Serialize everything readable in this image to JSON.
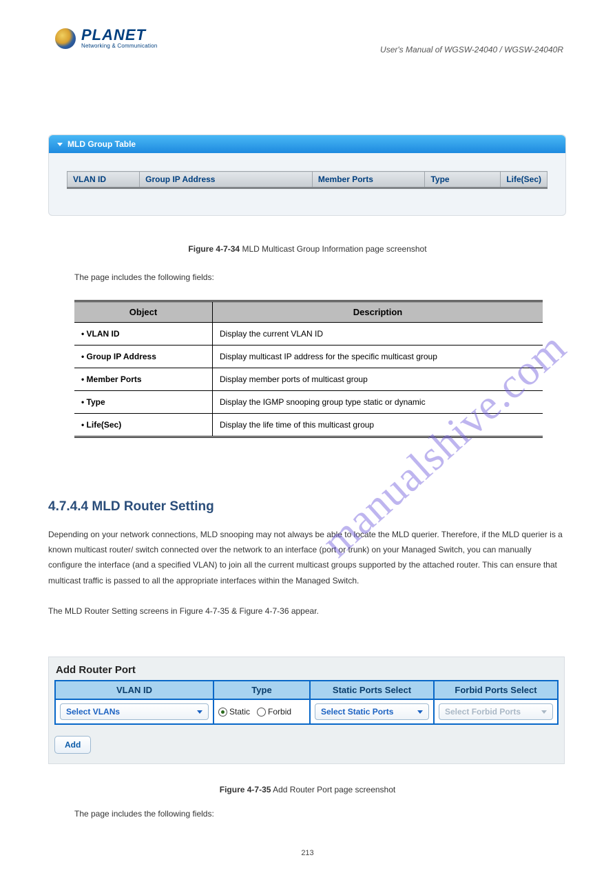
{
  "logo": {
    "main": "PLANET",
    "sub": "Networking & Communication"
  },
  "manual_header": "User's Manual of WGSW-24040 / WGSW-24040R",
  "watermark": "manualshive.com",
  "panel1": {
    "title": "MLD Group Table",
    "columns": [
      "VLAN ID",
      "Group IP Address",
      "Member Ports",
      "Type",
      "Life(Sec)"
    ]
  },
  "fig1": {
    "caption_strong": "Figure 4-7-34",
    "caption_rest": " MLD Multicast Group Information page screenshot"
  },
  "desc1": {
    "intro": "The page includes the following fields:",
    "header_obj": "Object",
    "header_desc": "Description",
    "rows": [
      {
        "obj": "• VLAN ID",
        "desc": "Display the current VLAN ID"
      },
      {
        "obj": "• Group IP Address",
        "desc": "Display multicast IP address for the specific multicast group"
      },
      {
        "obj": "• Member Ports",
        "desc": "Display member ports of multicast group"
      },
      {
        "obj": "• Type",
        "desc": "Display the IGMP snooping group type static or dynamic"
      },
      {
        "obj": "• Life(Sec)",
        "desc": "Display the life time of this multicast group"
      }
    ]
  },
  "section": {
    "heading": "4.7.4.4 MLD Router Setting",
    "body_1": "Depending on your network connections, MLD snooping may not always be able to locate the MLD querier. Therefore, if the MLD querier is a known multicast router/ switch connected over the network to an interface (port or trunk) on your Managed Switch, you can manually configure the interface (and a specified VLAN) to join all the current multicast groups supported by the attached router. This can ensure that multicast traffic is passed to all the appropriate interfaces within the Managed Switch.",
    "body_2": "The MLD Router Setting screens in Figure 4-7-35 & Figure 4-7-36 appear."
  },
  "panel2": {
    "title": "Add Router Port",
    "columns": [
      "VLAN ID",
      "Type",
      "Static Ports Select",
      "Forbid Ports Select"
    ],
    "select_vlans": "Select VLANs",
    "radio_static": "Static",
    "radio_forbid": "Forbid",
    "select_static": "Select Static Ports",
    "select_forbid": "Select Forbid Ports",
    "add_btn": "Add"
  },
  "fig2": {
    "caption_strong": "Figure 4-7-35",
    "caption_rest": " Add Router Port page screenshot"
  },
  "desc2": {
    "intro": "The page includes the following fields:"
  },
  "page_number": "213"
}
